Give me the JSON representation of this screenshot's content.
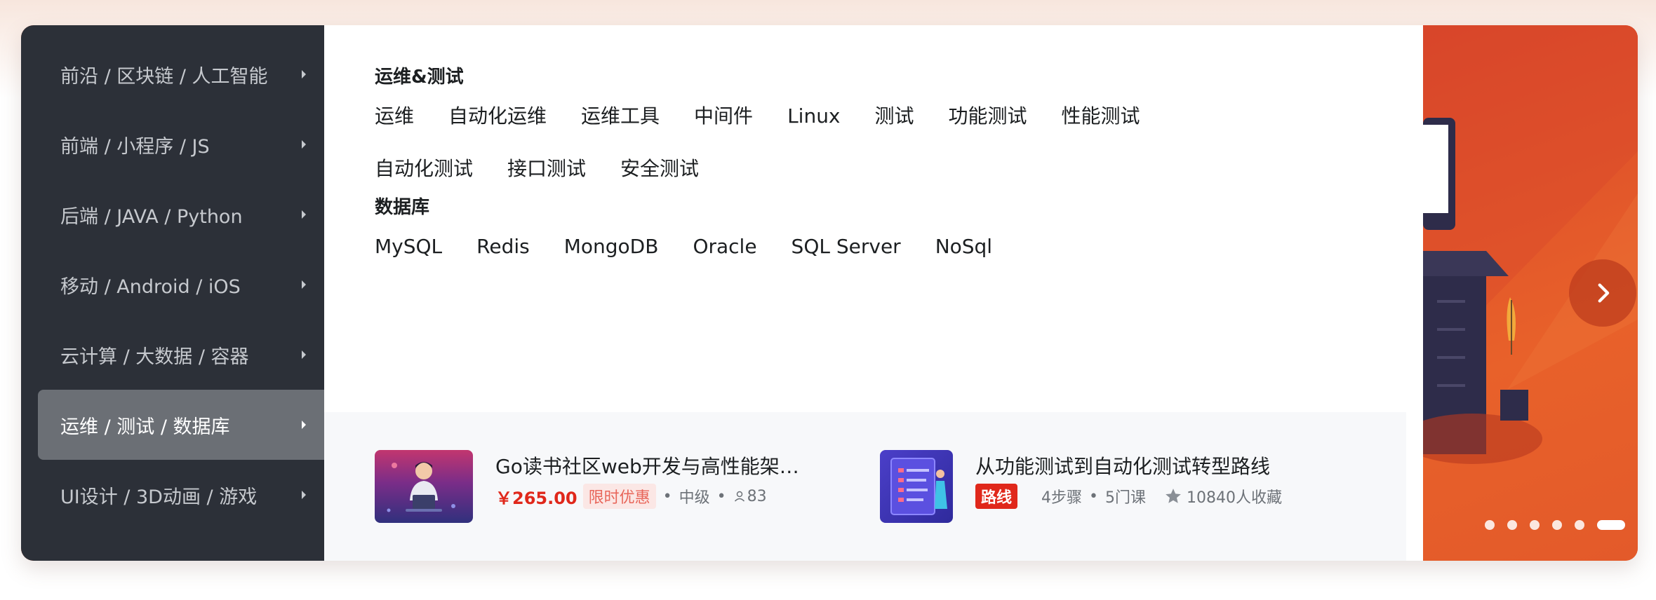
{
  "sidebar": {
    "items": [
      {
        "label": "前沿 / 区块链 / 人工智能",
        "active": false
      },
      {
        "label": "前端 / 小程序 / JS",
        "active": false
      },
      {
        "label": "后端 / JAVA / Python",
        "active": false
      },
      {
        "label": "移动 / Android / iOS",
        "active": false
      },
      {
        "label": "云计算 / 大数据 / 容器",
        "active": false
      },
      {
        "label": "运维 / 测试 / 数据库",
        "active": true
      },
      {
        "label": "UI设计 / 3D动画 / 游戏",
        "active": false
      }
    ]
  },
  "panel": {
    "sections": [
      {
        "title": "运维&测试",
        "tags": [
          "运维",
          "自动化运维",
          "运维工具",
          "中间件",
          "Linux",
          "测试",
          "功能测试",
          "性能测试",
          "自动化测试",
          "接口测试",
          "安全测试"
        ]
      },
      {
        "title": "数据库",
        "tags": [
          "MySQL",
          "Redis",
          "MongoDB",
          "Oracle",
          "SQL Server",
          "NoSql"
        ]
      }
    ],
    "recommendations": [
      {
        "title": "Go读书社区web开发与高性能架…",
        "price": "￥265.00",
        "promo": "限时优惠",
        "level": "中级",
        "students": "83"
      },
      {
        "title": "从功能测试到自动化测试转型路线",
        "badge": "路线",
        "steps": "4步骤",
        "courses": "5门课",
        "favorites": "10840人收藏"
      }
    ]
  },
  "banner": {
    "dots_count": 6,
    "active_dot": 5,
    "accent_color": "#e6552a"
  }
}
